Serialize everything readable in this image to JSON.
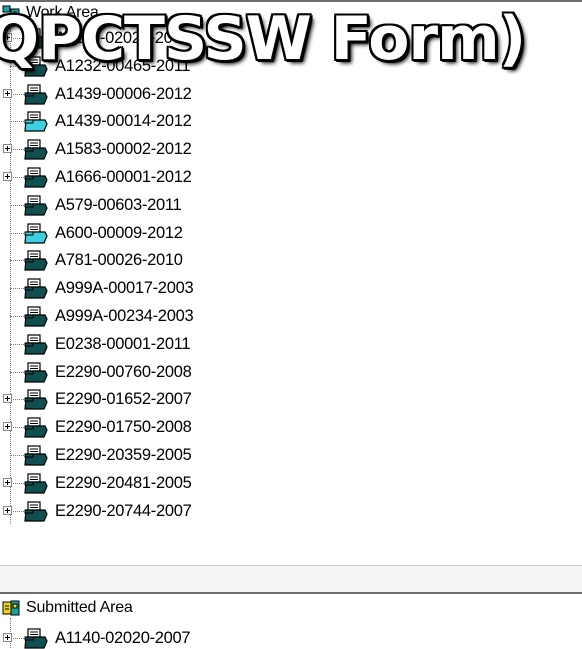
{
  "work_area": {
    "title": "Work Area",
    "items": [
      {
        "label": "A1140-02020-2007",
        "icon": "folder-printer-dark",
        "expandable": true
      },
      {
        "label": "A1232-00465-2011",
        "icon": "folder-printer-dark",
        "expandable": false
      },
      {
        "label": "A1439-00006-2012",
        "icon": "folder-printer-dark",
        "expandable": true
      },
      {
        "label": "A1439-00014-2012",
        "icon": "folder-printer-cyan",
        "expandable": false
      },
      {
        "label": "A1583-00002-2012",
        "icon": "folder-printer-dark",
        "expandable": true
      },
      {
        "label": "A1666-00001-2012",
        "icon": "folder-printer-dark",
        "expandable": true
      },
      {
        "label": "A579-00603-2011",
        "icon": "folder-printer-dark",
        "expandable": false
      },
      {
        "label": "A600-00009-2012",
        "icon": "folder-printer-cyan",
        "expandable": false
      },
      {
        "label": "A781-00026-2010",
        "icon": "folder-printer-dark",
        "expandable": false
      },
      {
        "label": "A999A-00017-2003",
        "icon": "folder-printer-dark",
        "expandable": false
      },
      {
        "label": "A999A-00234-2003",
        "icon": "folder-printer-dark",
        "expandable": false
      },
      {
        "label": "E0238-00001-2011",
        "icon": "folder-printer-dark",
        "expandable": false
      },
      {
        "label": "E2290-00760-2008",
        "icon": "folder-printer-dark",
        "expandable": false
      },
      {
        "label": "E2290-01652-2007",
        "icon": "folder-printer-dark",
        "expandable": true
      },
      {
        "label": "E2290-01750-2008",
        "icon": "folder-printer-dark",
        "expandable": true
      },
      {
        "label": "E2290-20359-2005",
        "icon": "folder-printer-dark",
        "expandable": false
      },
      {
        "label": "E2290-20481-2005",
        "icon": "folder-printer-dark",
        "expandable": true
      },
      {
        "label": "E2290-20744-2007",
        "icon": "folder-printer-dark",
        "expandable": true
      }
    ]
  },
  "submitted_area": {
    "title": "Submitted Area",
    "items": [
      {
        "label": "A1140-02020-2007",
        "icon": "folder-printer-dark",
        "expandable": true
      }
    ]
  },
  "overlay_text": "QPCTSSW Form)",
  "colors": {
    "icon_dark": "#0f4f4f",
    "icon_cyan": "#3fd0e0",
    "header_icon_teal": "#1aa3a3",
    "header_icon_yellow": "#f2d21a"
  }
}
